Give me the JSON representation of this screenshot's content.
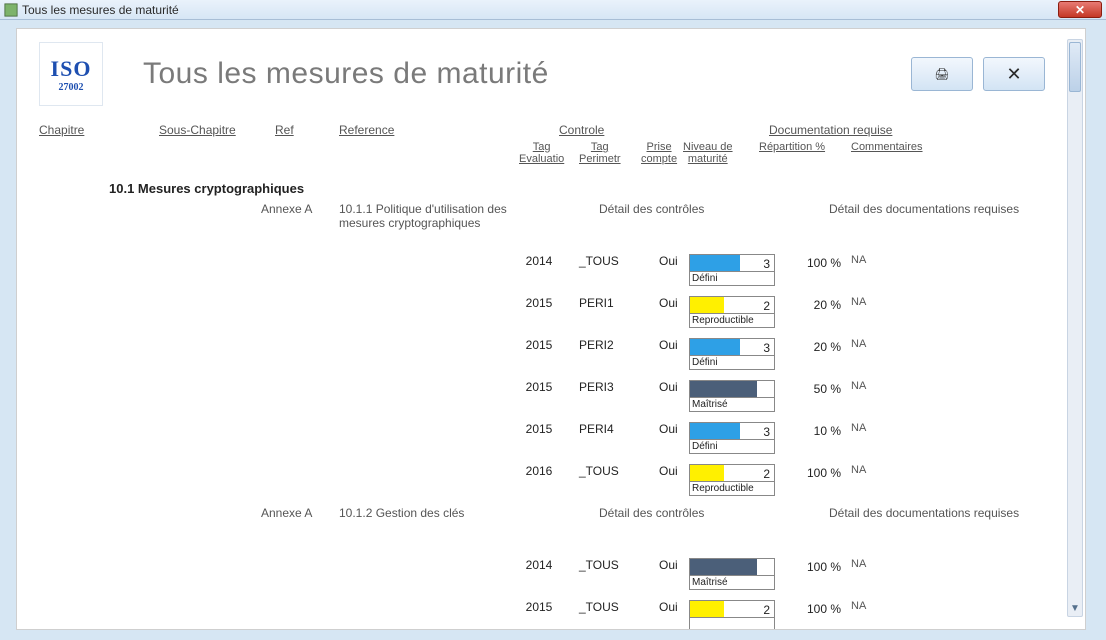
{
  "window": {
    "title": "Tous les mesures de maturité"
  },
  "header": {
    "logo_top": "ISO",
    "logo_bottom": "27002",
    "title": "Tous les mesures de maturité",
    "print_label": "Print",
    "close_label": "✕"
  },
  "columns": {
    "chapitre": "Chapitre",
    "sous_chapitre": "Sous-Chapitre",
    "ref": "Ref",
    "reference": "Reference",
    "controle": "Controle",
    "documentation": "Documentation requise"
  },
  "subcolumns": {
    "tag_eval": "Tag\nEvaluatio",
    "tag_perim": "Tag\nPerimetr",
    "prise": "Prise\ncompte",
    "niveau": "Niveau de\nmaturité",
    "repartition": "Répartition %",
    "commentaires": "Commentaires"
  },
  "section": {
    "title": "10.1 Mesures cryptographiques"
  },
  "refs": [
    {
      "annexe": "Annexe A",
      "ref_title": "10.1.1 Politique d'utilisation des mesures cryptographiques",
      "detail_ctrl": "Détail des contrôles",
      "detail_doc": "Détail des documentations requises",
      "rows": [
        {
          "tag": "2014",
          "perim": "_TOUS",
          "prise": "Oui",
          "niveau": 3,
          "fill": 60,
          "color": "c-blue",
          "label": "Défini",
          "pct": "100 %",
          "com": "NA"
        },
        {
          "tag": "2015",
          "perim": "PERI1",
          "prise": "Oui",
          "niveau": 2,
          "fill": 40,
          "color": "c-yellow",
          "label": "Reproductible",
          "pct": "20 %",
          "com": "NA"
        },
        {
          "tag": "2015",
          "perim": "PERI2",
          "prise": "Oui",
          "niveau": 3,
          "fill": 60,
          "color": "c-blue",
          "label": "Défini",
          "pct": "20 %",
          "com": "NA"
        },
        {
          "tag": "2015",
          "perim": "PERI3",
          "prise": "Oui",
          "niveau": 4,
          "fill": 80,
          "color": "c-slate",
          "label": "Maîtrisé",
          "pct": "50 %",
          "com": "NA"
        },
        {
          "tag": "2015",
          "perim": "PERI4",
          "prise": "Oui",
          "niveau": 3,
          "fill": 60,
          "color": "c-blue",
          "label": "Défini",
          "pct": "10 %",
          "com": "NA"
        },
        {
          "tag": "2016",
          "perim": "_TOUS",
          "prise": "Oui",
          "niveau": 2,
          "fill": 40,
          "color": "c-yellow",
          "label": "Reproductible",
          "pct": "100 %",
          "com": "NA"
        }
      ]
    },
    {
      "annexe": "Annexe A",
      "ref_title": "10.1.2 Gestion des clés",
      "detail_ctrl": "Détail des contrôles",
      "detail_doc": "Détail des documentations requises",
      "rows": [
        {
          "tag": "2014",
          "perim": "_TOUS",
          "prise": "Oui",
          "niveau": 4,
          "fill": 80,
          "color": "c-slate",
          "label": "Maîtrisé",
          "pct": "100 %",
          "com": "NA"
        },
        {
          "tag": "2015",
          "perim": "_TOUS",
          "prise": "Oui",
          "niveau": 2,
          "fill": 40,
          "color": "c-yellow",
          "label": "",
          "pct": "100 %",
          "com": "NA"
        }
      ]
    }
  ]
}
